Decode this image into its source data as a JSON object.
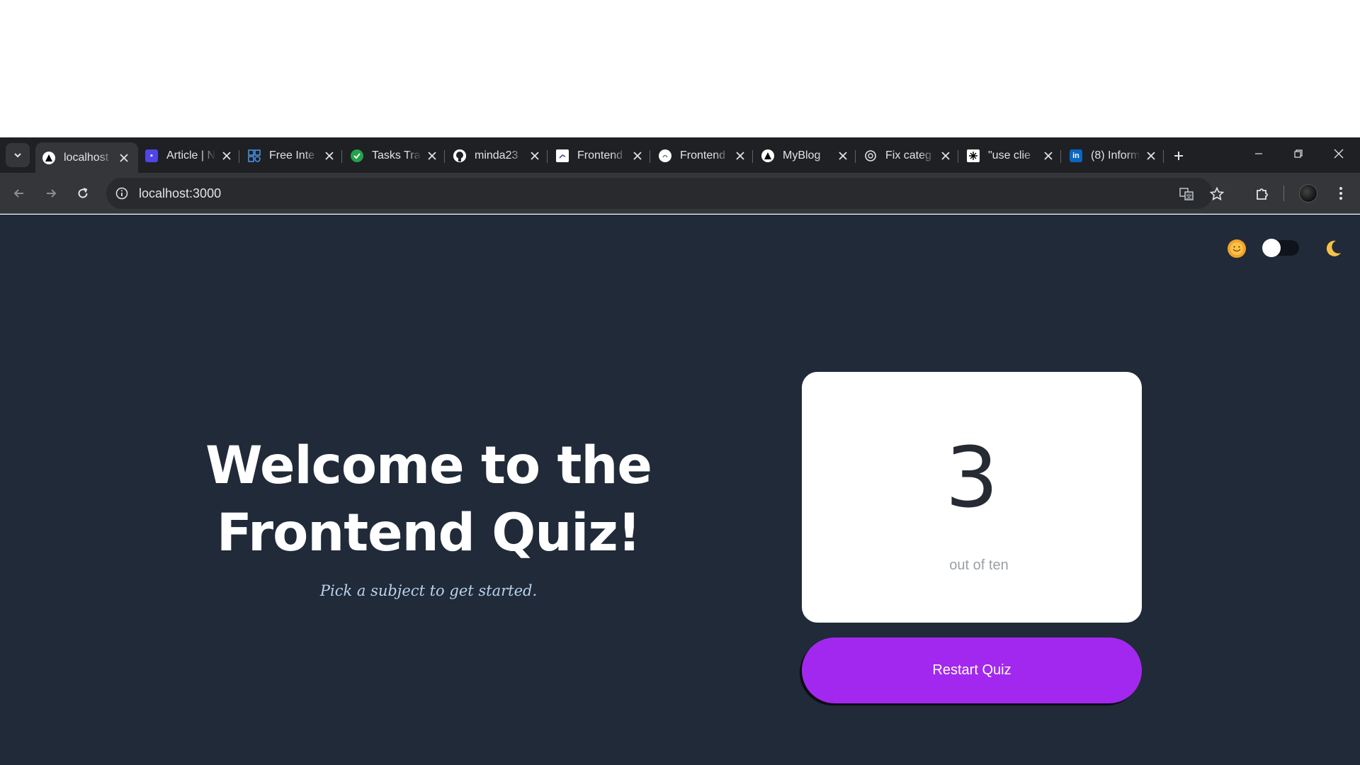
{
  "browser": {
    "tabs": [
      {
        "title": "localhost",
        "favicon": "nextjs-triangle-icon",
        "active": true
      },
      {
        "title": "Article | N",
        "favicon": "article-app-icon"
      },
      {
        "title": "Free Inte",
        "favicon": "grid-app-icon"
      },
      {
        "title": "Tasks Tra",
        "favicon": "check-circle-icon"
      },
      {
        "title": "minda23",
        "favicon": "github-icon"
      },
      {
        "title": "Frontend",
        "favicon": "frontend-mentor-icon"
      },
      {
        "title": "Frontend",
        "favicon": "frontend-circle-icon"
      },
      {
        "title": "MyBlog",
        "favicon": "nextjs-triangle-icon"
      },
      {
        "title": "Fix categ",
        "favicon": "openai-icon"
      },
      {
        "title": "\"use clie",
        "favicon": "use-client-icon"
      },
      {
        "title": "(8) Inform",
        "favicon": "linkedin-icon"
      }
    ],
    "url": "localhost:3000"
  },
  "theme": {
    "sun_icon": "sun-icon",
    "moon_icon": "moon-icon",
    "dark_mode": false
  },
  "hero": {
    "title_line1": "Welcome to the",
    "title_line2": "Frontend Quiz!",
    "subtitle": "Pick a subject to get started."
  },
  "score": {
    "value": "3",
    "caption": "out of ten"
  },
  "restart_button": "Restart Quiz",
  "colors": {
    "page_bg": "#202a38",
    "accent": "#a328ef",
    "card_bg": "#ffffff"
  }
}
